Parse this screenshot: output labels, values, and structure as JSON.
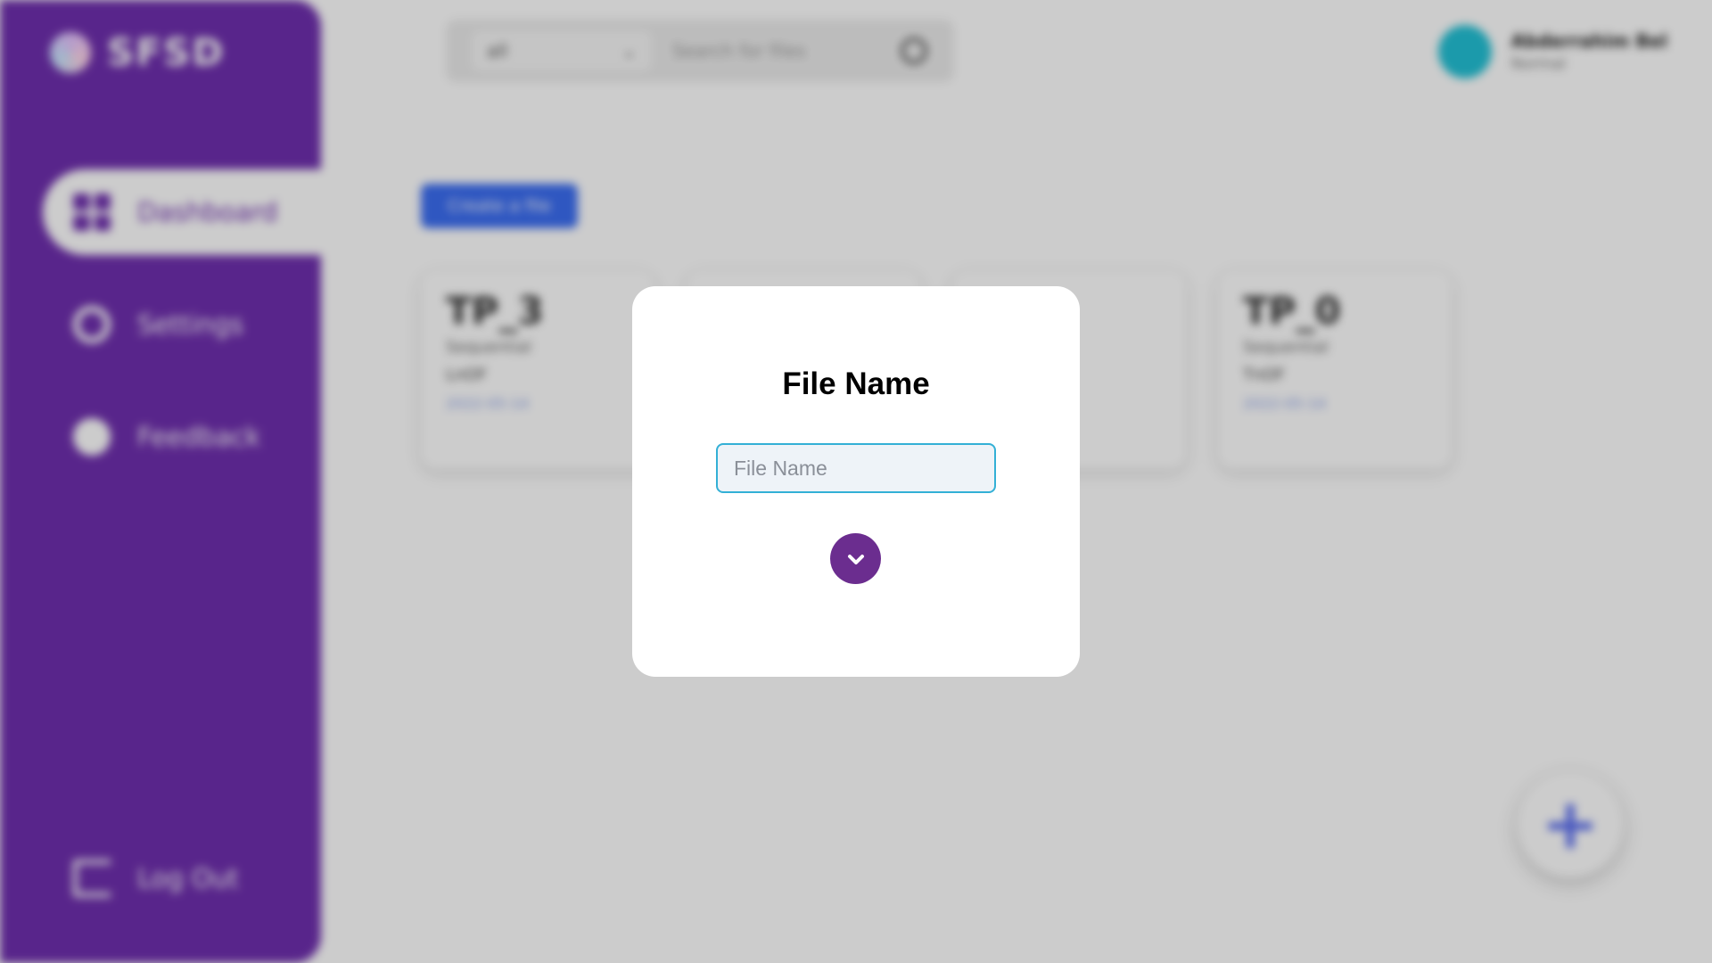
{
  "app": {
    "brand": "SFSD",
    "colors": {
      "sidebar": "#6f2fae",
      "accent": "#6b2d8f",
      "input_border": "#33b0d6",
      "upload_button": "#3b6df2"
    }
  },
  "sidebar": {
    "items": [
      {
        "label": "Dashboard",
        "icon": "dashboard-icon",
        "active": true
      },
      {
        "label": "Settings",
        "icon": "gear-icon"
      },
      {
        "label": "Feedback",
        "icon": "feedback-icon"
      }
    ],
    "logout_label": "Log Out"
  },
  "topbar": {
    "search_select_value": "all",
    "search_placeholder": "Search for files",
    "user_name": "Abderrahim Bel",
    "user_role": "Normal"
  },
  "main": {
    "upload_label": "Create a file",
    "cards": [
      {
        "title": "TP_3",
        "type": "Sequential",
        "status": "LnOF",
        "date": "2022-05-14"
      },
      {
        "title": "TP_0",
        "type": "Sequential",
        "status": "TnOF",
        "date": "2022-05-14"
      }
    ]
  },
  "modal": {
    "title": "File Name",
    "input_placeholder": "File Name",
    "input_value": "",
    "confirm_icon": "chevron-down-icon"
  }
}
